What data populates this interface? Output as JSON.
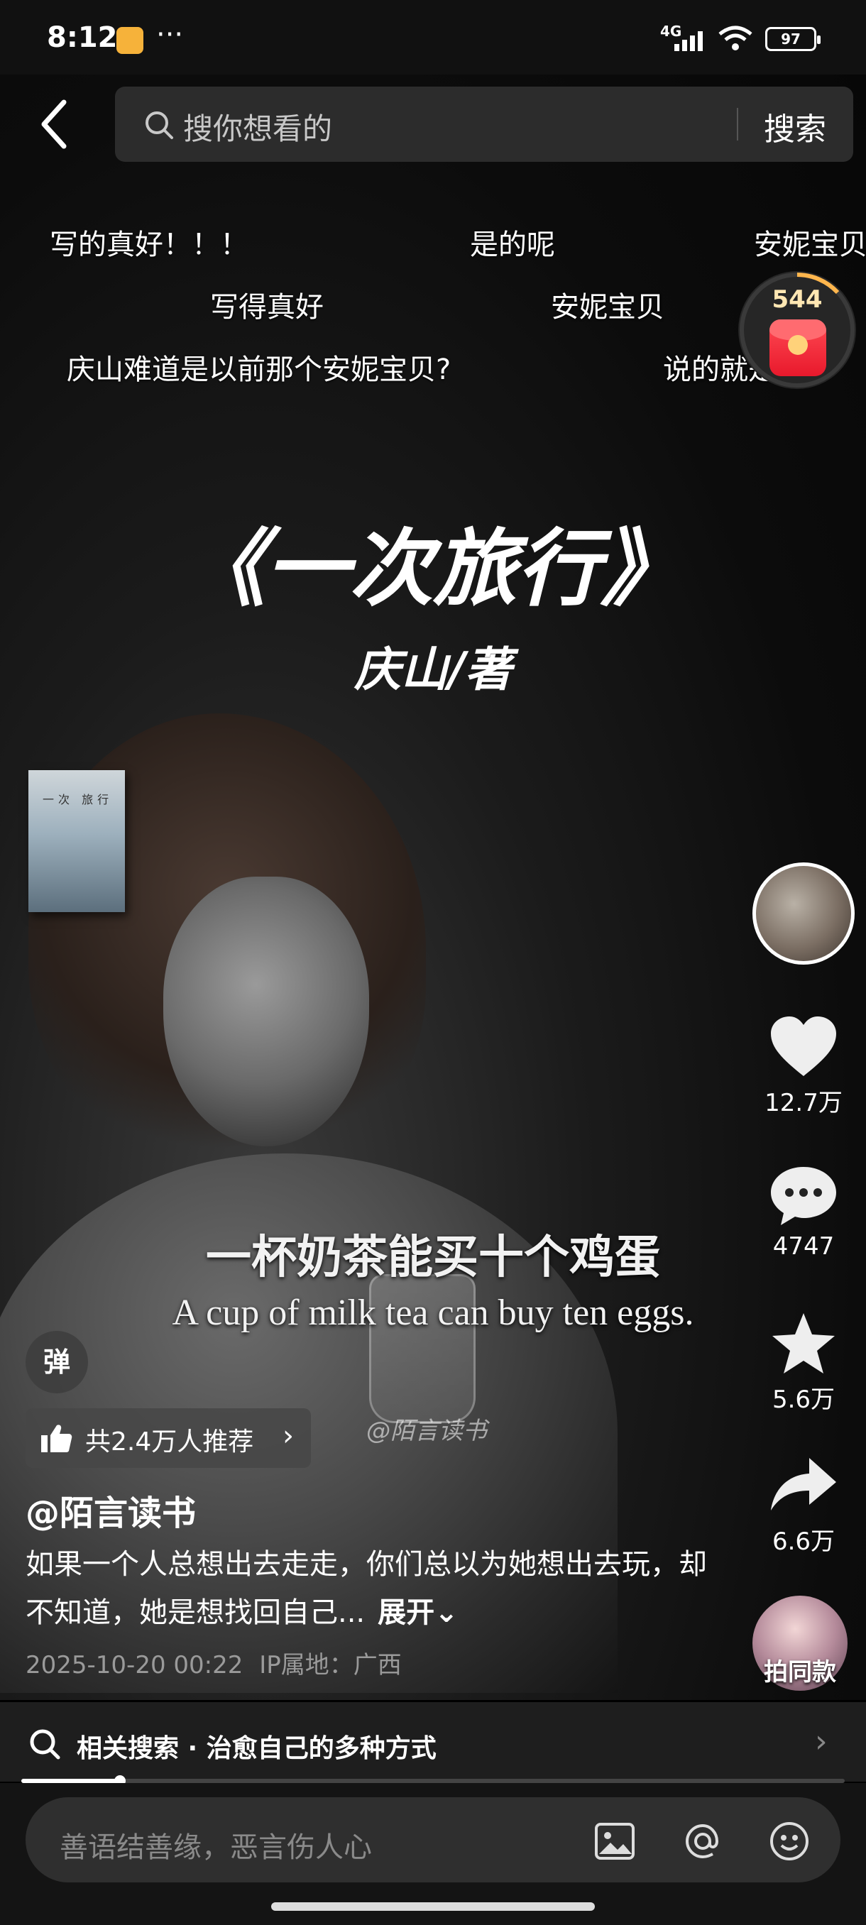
{
  "status_bar": {
    "time": "8:12",
    "dots": "···",
    "network": "4G",
    "battery": "97"
  },
  "search": {
    "placeholder": "搜你想看的",
    "button": "搜索"
  },
  "danmaku": [
    {
      "text": "写的真好！！！"
    },
    {
      "text": "是的呢"
    },
    {
      "text": "安妮宝贝"
    },
    {
      "text": "写得真好"
    },
    {
      "text": "安妮宝贝"
    },
    {
      "text": "庆山难道是以前那个安妮宝贝?"
    },
    {
      "text": "说的就是"
    }
  ],
  "red_packet": {
    "count": "544"
  },
  "video": {
    "title": "《一次旅行》",
    "author": "庆山/著",
    "book_cover_text": "一次 旅行",
    "subtitle_cn": "一杯奶茶能买十个鸡蛋",
    "subtitle_en": "A cup of milk tea can buy ten eggs.",
    "watermark": "@陌言读书",
    "progress": 0.12
  },
  "actions": {
    "likes": "12.7万",
    "comments": "4747",
    "favorites": "5.6万",
    "shares": "6.6万",
    "same_style": "拍同款"
  },
  "danmaku_toggle": "弹",
  "recommend": {
    "text": "共2.4万人推荐",
    "chevron": "›"
  },
  "post": {
    "username": "@陌言读书",
    "description": "如果一个人总想出去走走，你们总以为她想出去玩，却不知道，她是想找回自己...",
    "expand": "展开⌄",
    "date": "2025-10-20 00:22",
    "ip": "IP属地：广西"
  },
  "related_search": {
    "text": "相关搜索 · 治愈自己的多种方式",
    "chevron": "›"
  },
  "comment_bar": {
    "placeholder": "善语结善缘，恶言伤人心"
  },
  "colors": {
    "background": "#000000",
    "accent_red": "#e8192c",
    "text_gray": "#9a9a9a"
  }
}
